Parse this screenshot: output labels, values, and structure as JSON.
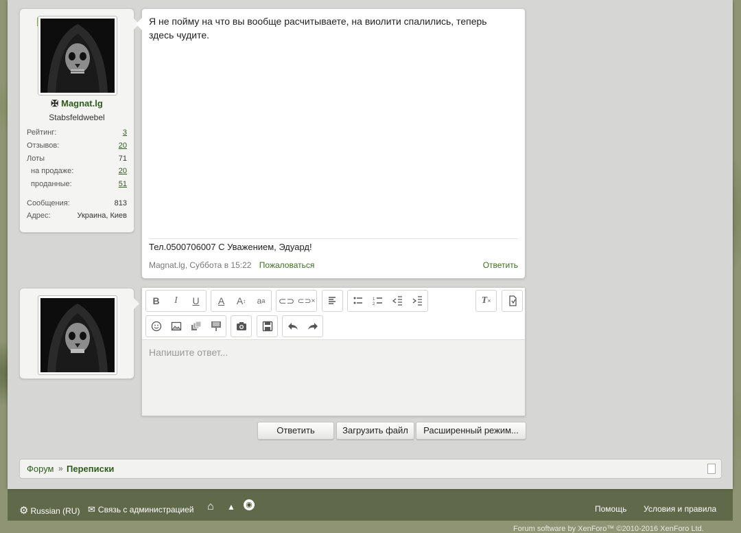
{
  "post": {
    "author": {
      "name": "Magnat.lg",
      "title": "Stabsfeldwebel",
      "stats": [
        {
          "label": "Рейтинг:",
          "value": "3",
          "link": true
        },
        {
          "label": "Отзывов:",
          "value": "20",
          "link": true
        },
        {
          "label": "Лоты",
          "value": "71",
          "link": false
        },
        {
          "label": "на продаже:",
          "value": "20",
          "link": true
        },
        {
          "label": "проданные:",
          "value": "51",
          "link": true
        },
        {
          "label": "Сообщения:",
          "value": "813",
          "link": false
        },
        {
          "label": "Адрес:",
          "value": "Украина, Киев",
          "link": false
        }
      ]
    },
    "text": "Я не пойму на что вы вообще расчитываете, на виолити спалились, теперь здесь чудите.",
    "signature": "Тел.0500706007 С Уважением, Эдуард!",
    "meta": "Magnat.lg, Суббота в 15:22",
    "report_label": "Пожаловаться",
    "reply_label": "Ответить"
  },
  "editor": {
    "placeholder": "Напишите ответ...",
    "toolbar_icons": [
      "bold-icon",
      "italic-icon",
      "underline-icon",
      "font-color-icon",
      "font-size-icon",
      "font-family-icon",
      "link-icon",
      "unlink-icon",
      "align-icon",
      "bullet-list-icon",
      "number-list-icon",
      "outdent-icon",
      "indent-icon",
      "remove-format-icon",
      "toggle-bbcode-icon",
      "smilies-icon",
      "image-icon",
      "media-icon",
      "insert-icon",
      "photo-icon",
      "save-draft-icon",
      "undo-icon",
      "redo-icon"
    ]
  },
  "buttons": {
    "reply": "Ответить",
    "upload": "Загрузить файл",
    "advanced": "Расширенный режим..."
  },
  "breadcrumb": {
    "home": "Форум",
    "separator": "»",
    "current": "Переписки"
  },
  "footer": {
    "language": "Russian (RU)",
    "contact": "Связь с администрацией",
    "help": "Помощь",
    "terms": "Условия и правила",
    "copyright": "Forum software by XenForo™ ©2010-2016 XenForo Ltd."
  },
  "colors": {
    "accent": "#2f5a1d",
    "link": "#3d6b23",
    "online": "#7fb23c"
  }
}
